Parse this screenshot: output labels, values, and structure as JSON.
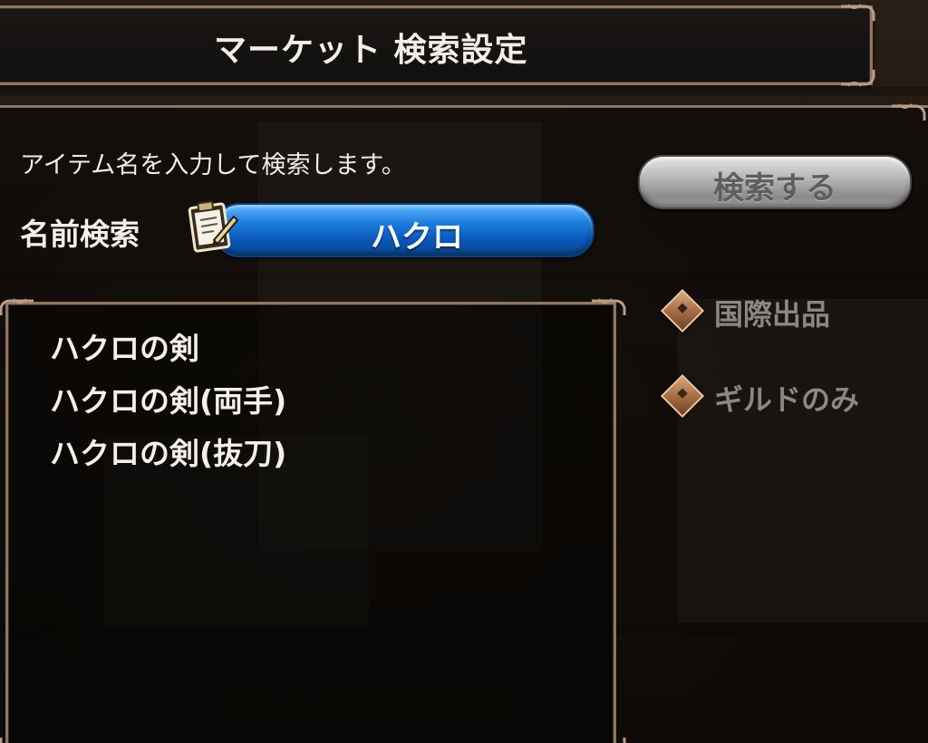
{
  "header": {
    "title": "マーケット 検索設定"
  },
  "search": {
    "instruction": "アイテム名を入力して検索します。",
    "name_label": "名前検索",
    "value": "ハクロ",
    "button_label": "検索する"
  },
  "results": {
    "items": [
      {
        "label": "ハクロの剣"
      },
      {
        "label": "ハクロの剣(両手)"
      },
      {
        "label": "ハクロの剣(抜刀)"
      }
    ]
  },
  "filters": {
    "items": [
      {
        "label": "国際出品",
        "icon": "diamond-toggle-icon"
      },
      {
        "label": "ギルドのみ",
        "icon": "diamond-toggle-icon"
      }
    ]
  },
  "colors": {
    "frame": "#8d7663",
    "search_field": "#1d7fe0",
    "search_button": "#b9b9b9",
    "filter_diamond": "#a86e46",
    "filter_text_inactive": "#8b8782"
  }
}
